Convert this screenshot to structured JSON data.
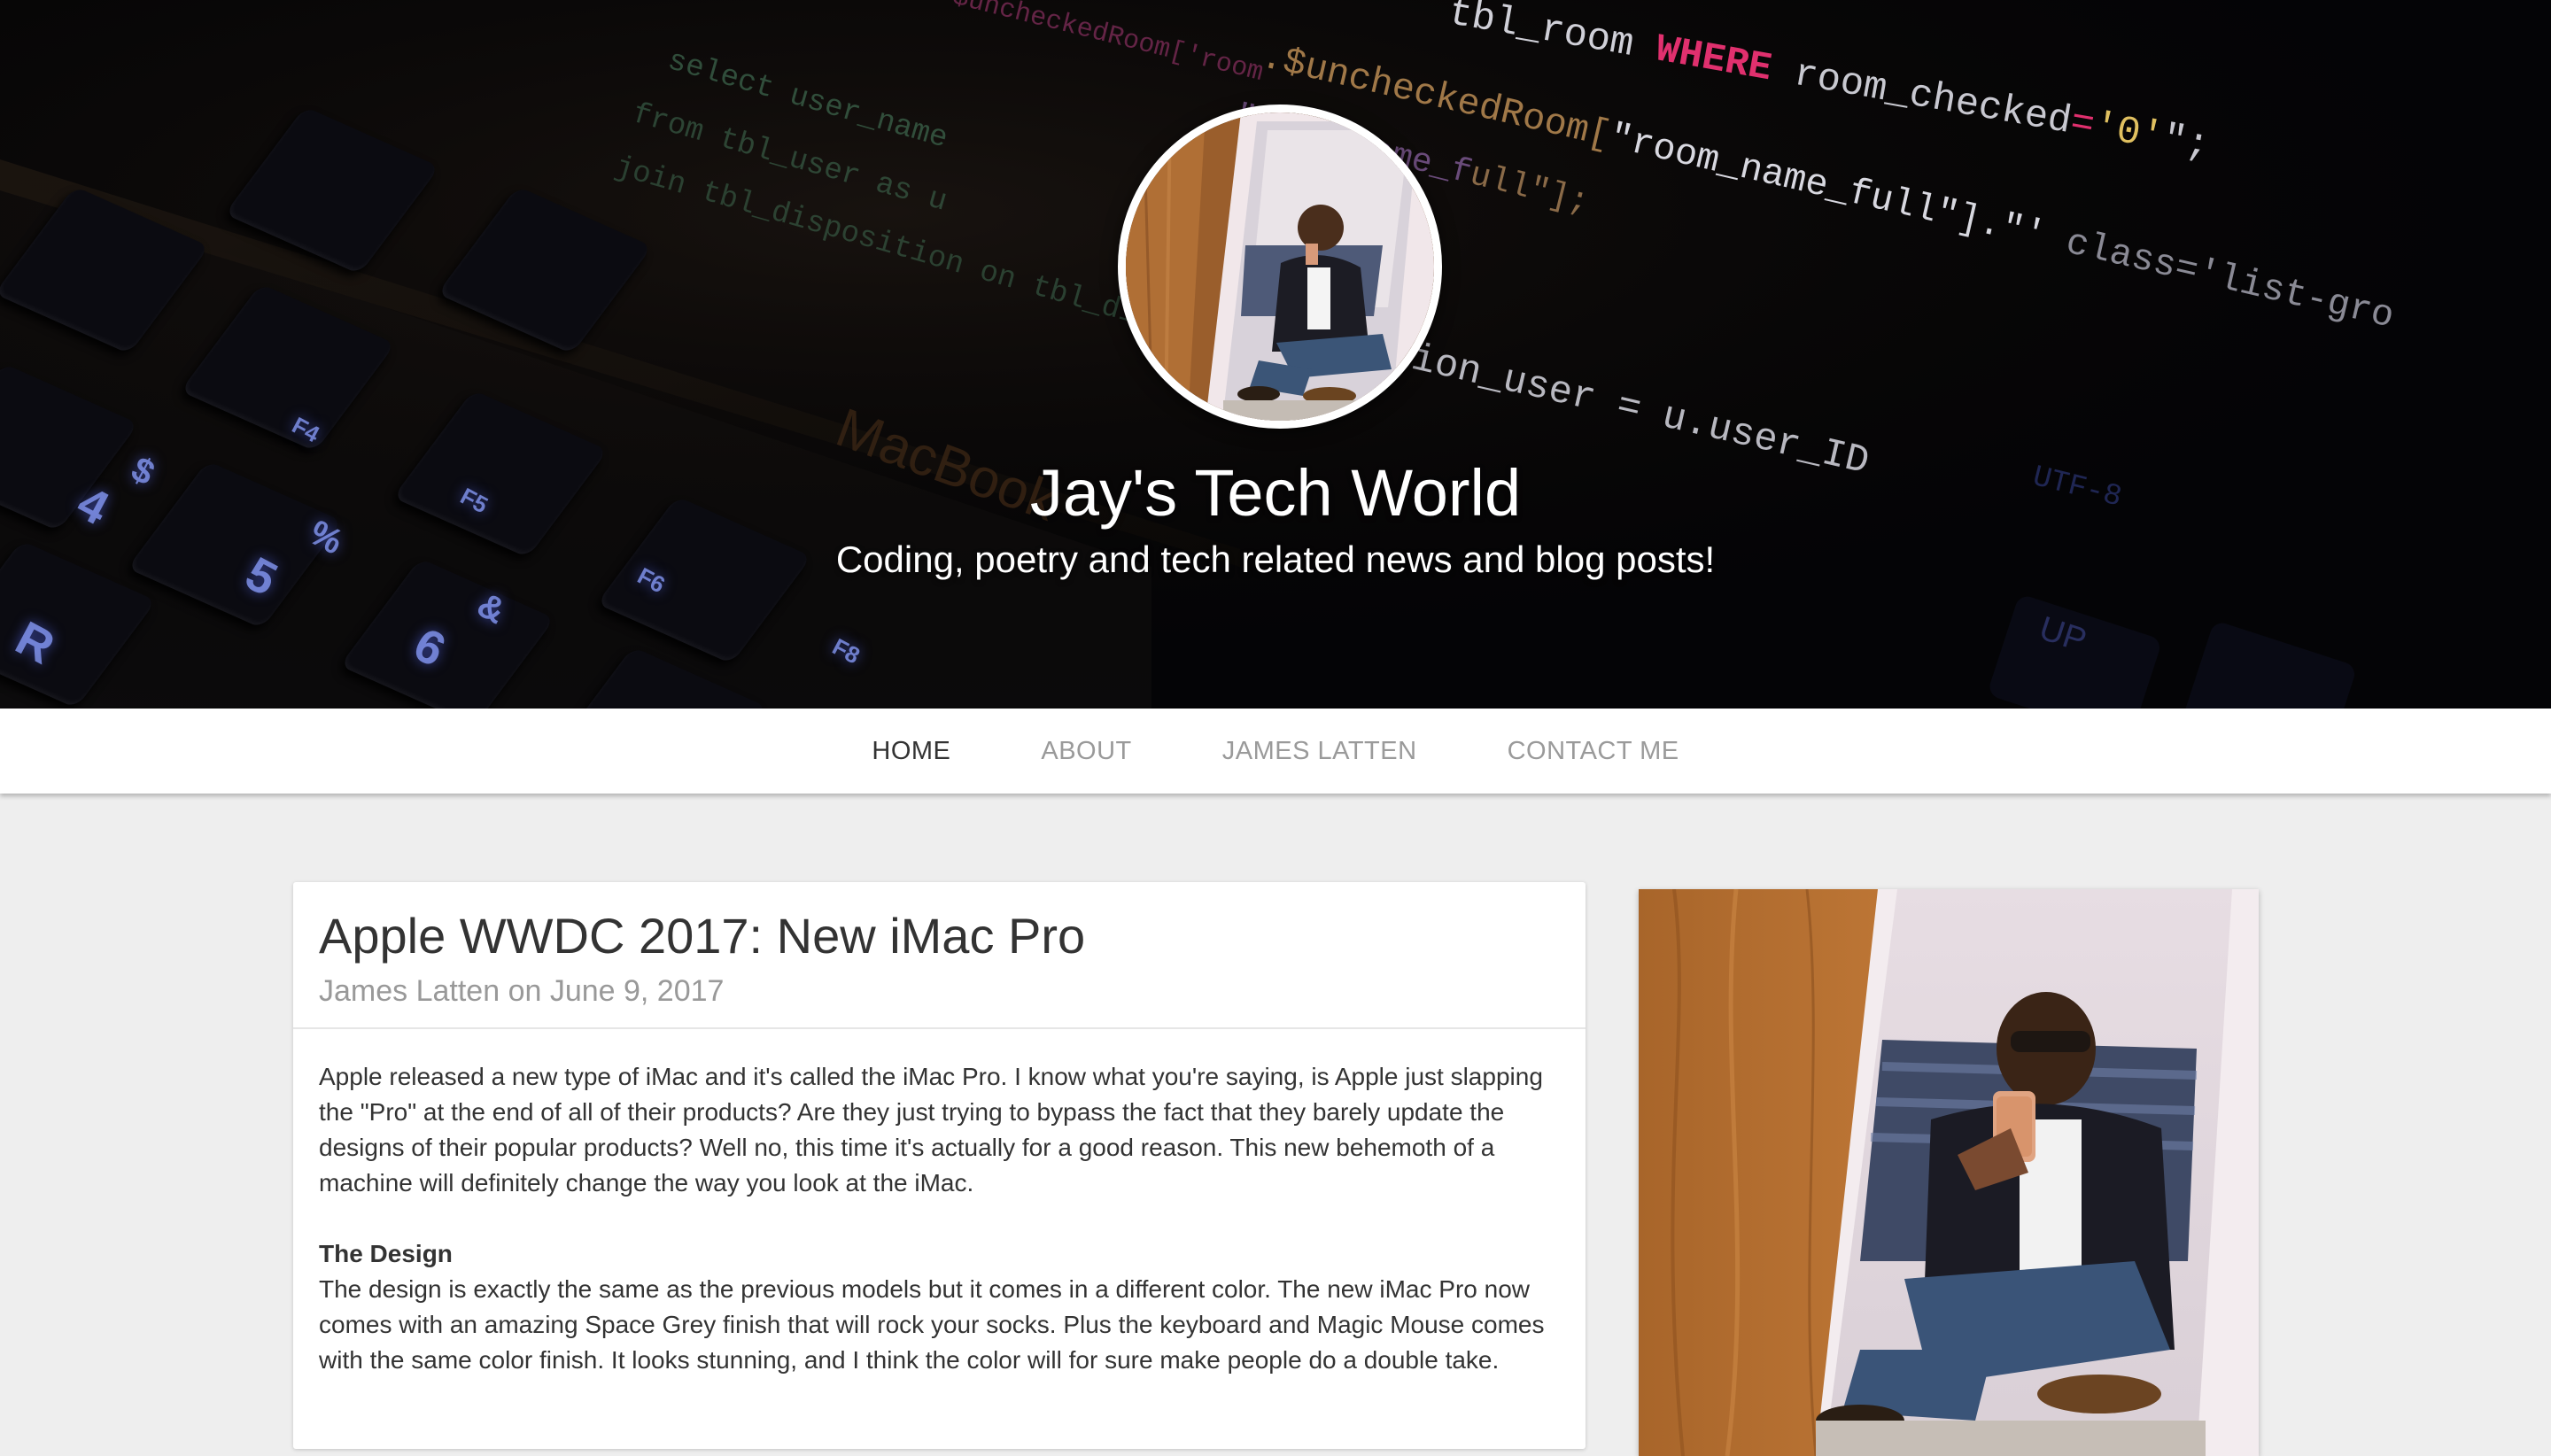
{
  "header": {
    "site_title": "Jay's Tech World",
    "tagline": "Coding, poetry and tech related news and blog posts!"
  },
  "nav": {
    "items": [
      {
        "label": "HOME",
        "active": true
      },
      {
        "label": "ABOUT",
        "active": false
      },
      {
        "label": "JAMES LATTEN",
        "active": false
      },
      {
        "label": "CONTACT ME",
        "active": false
      }
    ]
  },
  "post": {
    "title": "Apple WWDC 2017: New iMac Pro",
    "meta": "James Latten on June 9, 2017",
    "intro": "Apple released a new type of iMac and it's called the iMac Pro. I know what you're saying, is Apple just slapping the \"Pro\" at the end of all of their products? Are they just trying to bypass the fact that they barely update the designs of their popular products? Well no, this time it's actually for a good reason. This new behemoth of a machine will definitely change the way you look at the iMac.",
    "section_heading": "The Design",
    "section_text": "The design is exactly the same as the previous models but it comes in a different color. The new iMac Pro now comes with an amazing Space Grey finish that will rock your socks. Plus the keyboard and Magic Mouse comes with the same color finish. It looks stunning, and I think the color will for sure make people do a double take."
  },
  "colors": {
    "page_background": "#eeeeee",
    "nav_active": "#333333",
    "nav_inactive": "#9a9a9a",
    "meta_text": "#999999"
  },
  "icons": {
    "avatar": "profile-photo",
    "sidebar_photo": "profile-photo"
  }
}
